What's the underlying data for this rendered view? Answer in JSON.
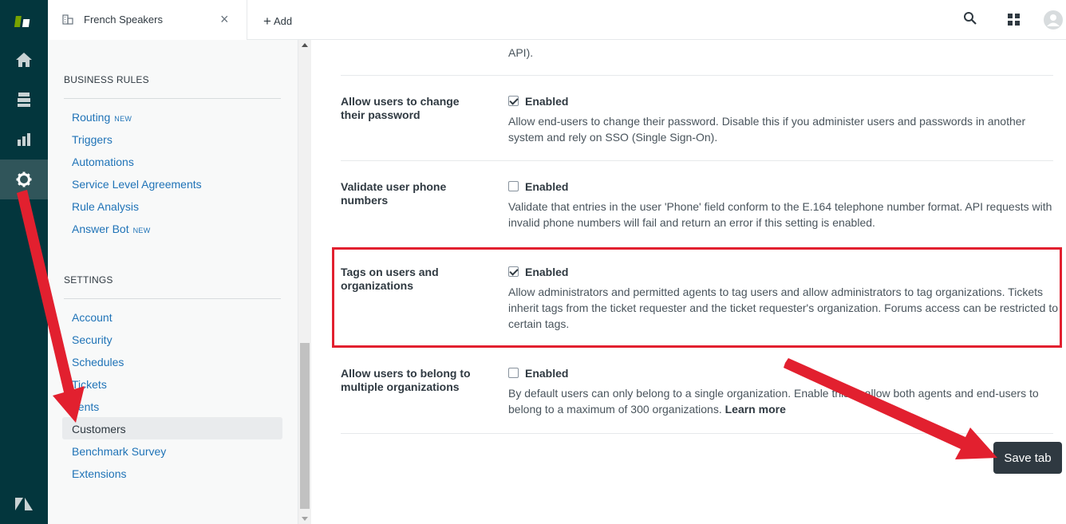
{
  "header": {
    "tab_title": "French Speakers",
    "tab_close": "×",
    "add_label": "Add"
  },
  "sidebar": {
    "business_rules": {
      "title": "BUSINESS RULES",
      "items": [
        {
          "label": "Routing",
          "badge": "NEW"
        },
        {
          "label": "Triggers"
        },
        {
          "label": "Automations"
        },
        {
          "label": "Service Level Agreements"
        },
        {
          "label": "Rule Analysis"
        },
        {
          "label": "Answer Bot",
          "badge": "NEW"
        }
      ]
    },
    "settings": {
      "title": "SETTINGS",
      "items": [
        {
          "label": "Account"
        },
        {
          "label": "Security"
        },
        {
          "label": "Schedules"
        },
        {
          "label": "Tickets"
        },
        {
          "label": "gents"
        },
        {
          "label": "Customers",
          "active": true
        },
        {
          "label": "Benchmark Survey"
        },
        {
          "label": "Extensions"
        }
      ]
    }
  },
  "main": {
    "top_fragment": "API).",
    "settings": [
      {
        "label": "Allow users to change their password",
        "checked": true,
        "check_label": "Enabled",
        "description": "Allow end-users to change their password. Disable this if you administer users and passwords in another system and rely on SSO (Single Sign-On)."
      },
      {
        "label": "Validate user phone numbers",
        "checked": false,
        "check_label": "Enabled",
        "description": "Validate that entries in the user 'Phone' field conform to the E.164 telephone number format. API requests with invalid phone numbers will fail and return an error if this setting is enabled."
      },
      {
        "label": "Tags on users and organizations",
        "checked": true,
        "check_label": "Enabled",
        "description": "Allow administrators and permitted agents to tag users and allow administrators to tag organizations. Tickets inherit tags from the ticket requester and the ticket requester's organization. Forums access can be restricted to certain tags."
      },
      {
        "label": "Allow users to belong to multiple organizations",
        "checked": false,
        "check_label": "Enabled",
        "description": "By default users can only belong to a single organization. Enable this to allow both agents and end-users to belong to a maximum of 300 organizations.",
        "link": "Learn more"
      }
    ],
    "save_label": "Save tab"
  },
  "colors": {
    "nav_bg": "#03363d",
    "link": "#1f73b7",
    "highlight": "#e2202f",
    "button": "#2f3941"
  }
}
